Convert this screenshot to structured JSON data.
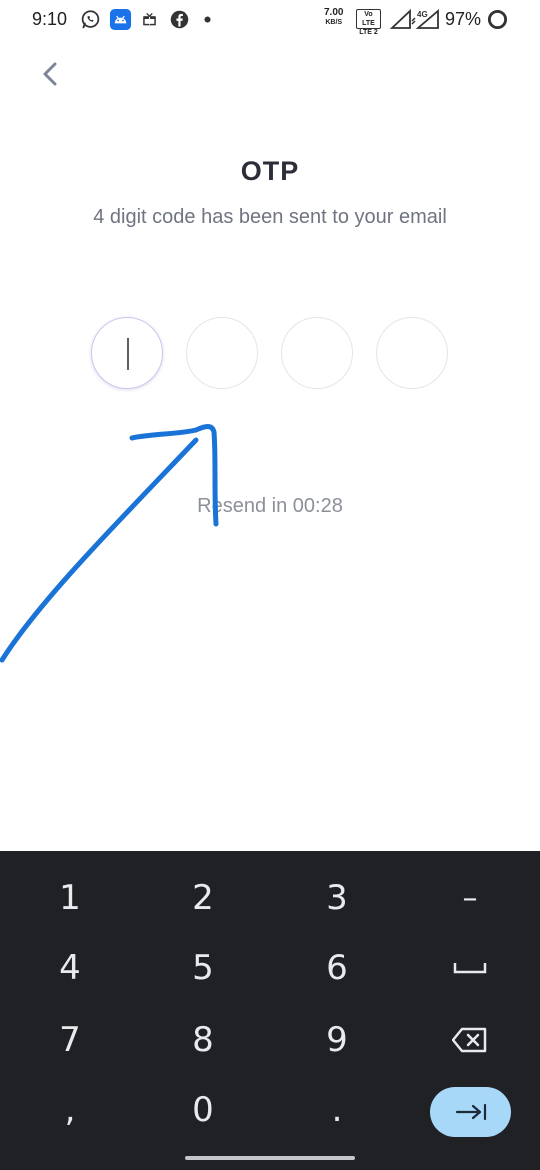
{
  "status_bar": {
    "time": "9:10",
    "net_speed_value": "7.00",
    "net_speed_unit": "KB/S",
    "volte_top": "Vo LTE",
    "volte_bottom": "LTE 2",
    "network_type": "4G",
    "battery_percent": "97%",
    "icons": [
      "whatsapp-icon",
      "android-icon",
      "gift-icon",
      "facebook-icon",
      "dot-icon",
      "signal-icon",
      "battery-icon"
    ]
  },
  "header": {
    "back_icon": "chevron-left-icon",
    "title": "OTP",
    "subtitle": "4 digit code has been sent to your email"
  },
  "otp": {
    "digits": [
      "",
      "",
      "",
      ""
    ],
    "active_index": 0
  },
  "resend": {
    "text": "Resend in 00:28"
  },
  "keyboard": {
    "rows": [
      [
        "1",
        "2",
        "3",
        "-"
      ],
      [
        "4",
        "5",
        "6",
        "space"
      ],
      [
        "7",
        "8",
        "9",
        "backspace"
      ],
      [
        ",",
        "0",
        ".",
        "enter"
      ]
    ],
    "labels": {
      "k1": "1",
      "k2": "2",
      "k3": "3",
      "kdash": "–",
      "k4": "4",
      "k5": "5",
      "k6": "6",
      "k7": "7",
      "k8": "8",
      "k9": "9",
      "kcomma": ",",
      "k0": "0",
      "kdot": "."
    },
    "accent": "#a8d8f8",
    "background": "#202124"
  },
  "colors": {
    "annotation": "#1a73d6",
    "title": "#2b2d38",
    "subtitle": "#6f7480"
  }
}
